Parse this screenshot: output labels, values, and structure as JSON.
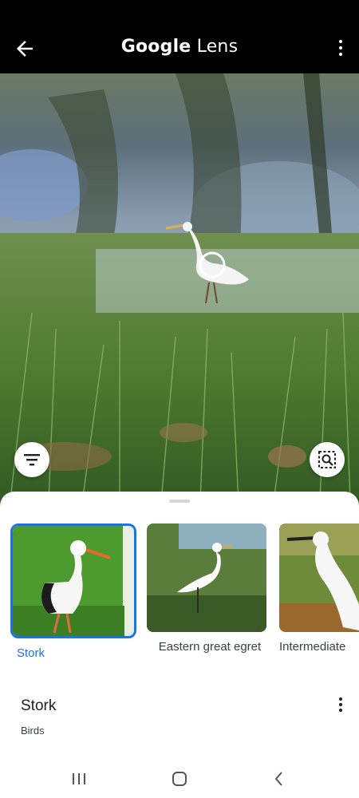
{
  "topbar": {
    "title_bold": "Google",
    "title_rest": " Lens",
    "back_icon": "arrow-left-icon",
    "more_icon": "more-vert-icon"
  },
  "photo": {
    "filter_icon": "filter-icon",
    "search_region_icon": "image-search-icon"
  },
  "results": [
    {
      "label": "Stork",
      "selected": true
    },
    {
      "label": "Eastern great egret",
      "selected": false
    },
    {
      "label": "Intermediate",
      "selected": false
    }
  ],
  "detail": {
    "title": "Stork",
    "subtitle": "Birds"
  },
  "navbar": {
    "items": [
      "recent-apps-icon",
      "home-icon",
      "back-nav-icon"
    ]
  },
  "colors": {
    "accent": "#1a73e8",
    "topbar_bg": "#000000"
  }
}
